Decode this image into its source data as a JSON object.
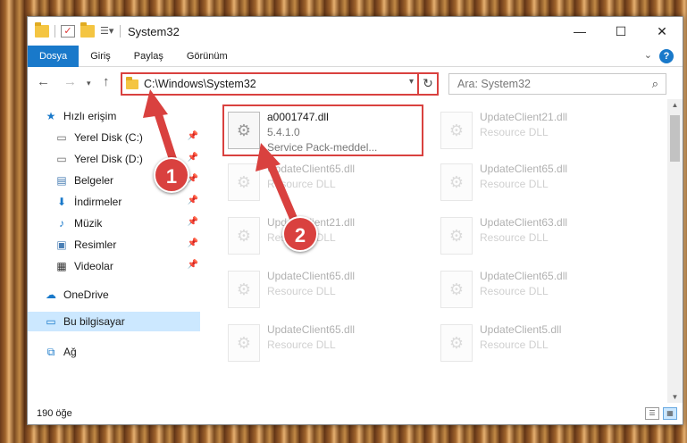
{
  "window": {
    "title": "System32",
    "minimize": "—",
    "maximize": "☐",
    "close": "✕"
  },
  "ribbon": {
    "tabs": [
      {
        "label": "Dosya"
      },
      {
        "label": "Giriş"
      },
      {
        "label": "Paylaş"
      },
      {
        "label": "Görünüm"
      }
    ],
    "help": "?"
  },
  "address": {
    "path": "C:\\Windows\\System32"
  },
  "search": {
    "placeholder": "Ara: System32"
  },
  "sidebar": {
    "items": [
      {
        "label": "Hızlı erişim",
        "icon": "star-icon"
      },
      {
        "label": "Yerel Disk (C:)",
        "icon": "drive-icon",
        "pinned": true
      },
      {
        "label": "Yerel Disk (D:)",
        "icon": "drive-icon",
        "pinned": true
      },
      {
        "label": "Belgeler",
        "icon": "documents-icon",
        "pinned": true
      },
      {
        "label": "İndirmeler",
        "icon": "download-icon",
        "pinned": true
      },
      {
        "label": "Müzik",
        "icon": "music-icon",
        "pinned": true
      },
      {
        "label": "Resimler",
        "icon": "pictures-icon",
        "pinned": true
      },
      {
        "label": "Videolar",
        "icon": "videos-icon",
        "pinned": true
      },
      {
        "label": "OneDrive",
        "icon": "cloud-icon"
      },
      {
        "label": "Bu bilgisayar",
        "icon": "computer-icon",
        "selected": true
      },
      {
        "label": "Ağ",
        "icon": "network-icon"
      }
    ]
  },
  "files": [
    {
      "name": "a0001747.dll",
      "line2": "5.4.1.0",
      "line3": "Service Pack-meddel..."
    },
    {
      "name": "UpdateClient21.dll",
      "line2": "Resource DLL"
    },
    {
      "name": "UpdateClient65.dll",
      "line2": "Resource DLL"
    },
    {
      "name": "UpdateClient65.dll",
      "line2": "Resource DLL"
    },
    {
      "name": "UpdateClient21.dll",
      "line2": "Resource DLL"
    },
    {
      "name": "UpdateClient63.dll",
      "line2": "Resource DLL"
    },
    {
      "name": "UpdateClient65.dll",
      "line2": "Resource DLL"
    },
    {
      "name": "UpdateClient65.dll",
      "line2": "Resource DLL"
    },
    {
      "name": "UpdateClient65.dll",
      "line2": "Resource DLL"
    },
    {
      "name": "UpdateClient5.dll",
      "line2": "Resource DLL"
    }
  ],
  "status": {
    "count": "190 öğe"
  },
  "callouts": {
    "one": "1",
    "two": "2"
  },
  "colors": {
    "accent": "#1979ca",
    "highlight": "#d9413f",
    "selection": "#cce8ff"
  }
}
